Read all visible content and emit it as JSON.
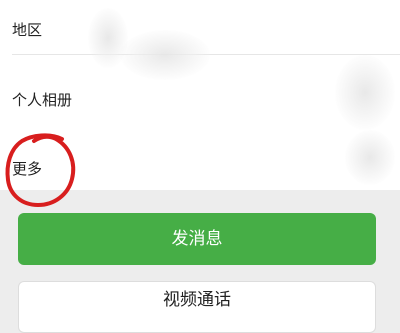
{
  "profile": {
    "items": [
      {
        "label": "地区"
      },
      {
        "label": "个人相册"
      },
      {
        "label": "更多"
      }
    ]
  },
  "actions": {
    "message_label": "发消息",
    "video_call_label": "视频通话"
  },
  "colors": {
    "primary_button": "#46ae46",
    "annotation": "#d81e1e",
    "background": "#ededed"
  }
}
